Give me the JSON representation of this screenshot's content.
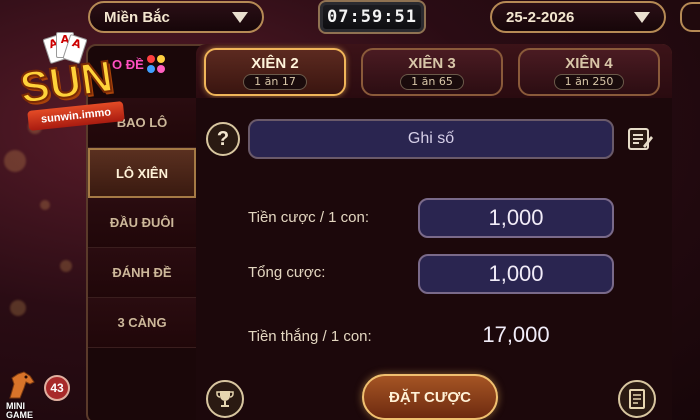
{
  "header": {
    "region": "Miền Bắc",
    "timer": "07:59:51",
    "date": "25-2-2026"
  },
  "logo": {
    "brand": "SUN",
    "domain": "sunwin.immo",
    "partial_label": "O ĐỀ"
  },
  "tabs": [
    {
      "label": "XIÊN 2",
      "odds": "1 ăn 17",
      "active": true
    },
    {
      "label": "XIÊN 3",
      "odds": "1 ăn 65",
      "active": false
    },
    {
      "label": "XIÊN 4",
      "odds": "1 ăn 250",
      "active": false
    }
  ],
  "sidebar": {
    "items": [
      {
        "label": "BAO LÔ",
        "active": false
      },
      {
        "label": "LÔ XIÊN",
        "active": true
      },
      {
        "label": "ĐẦU ĐUÔI",
        "active": false
      },
      {
        "label": "ĐÁNH ĐỀ",
        "active": false
      },
      {
        "label": "3 CÀNG",
        "active": false
      }
    ]
  },
  "form": {
    "help_symbol": "?",
    "number_placeholder": "Ghi số",
    "stake_label": "Tiền cược / 1 con:",
    "stake_value": "1,000",
    "total_label": "Tổng cược:",
    "total_value": "1,000",
    "win_label": "Tiền thắng / 1 con:",
    "win_value": "17,000"
  },
  "actions": {
    "bet_label": "ĐẶT CƯỢC"
  },
  "minigame": {
    "label_line1": "MINI",
    "label_line2": "GAME",
    "badge": "43"
  },
  "colors": {
    "accent_gold": "#f0b55a",
    "input_bg": "#2a2550",
    "panel_bg": "#1c080b"
  }
}
